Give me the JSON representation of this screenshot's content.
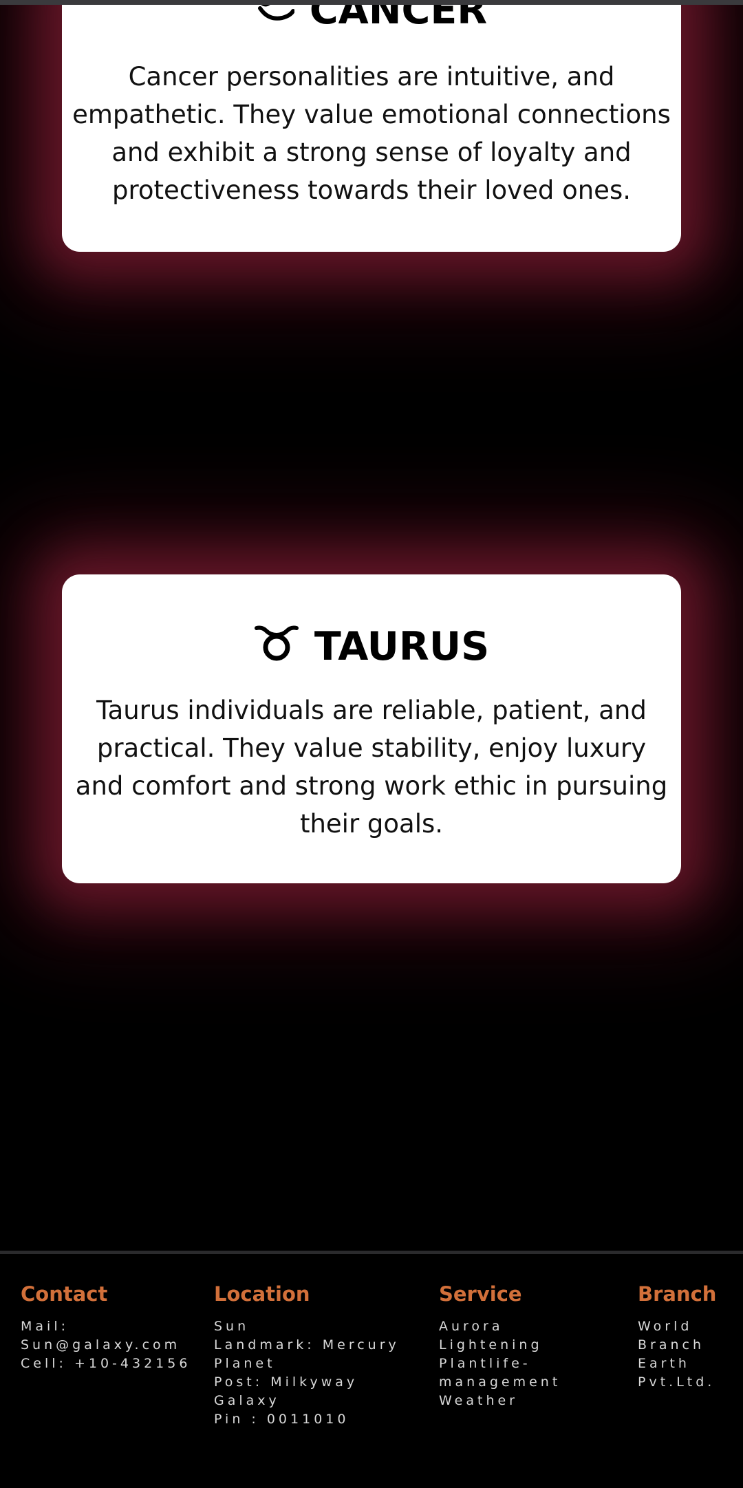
{
  "cards": [
    {
      "title": "CANCER",
      "icon": "cancer-zodiac-icon",
      "description": "Cancer personalities are intuitive, and empathetic. They value emotional connections and exhibit a strong sense of loyalty and protectiveness towards their loved ones."
    },
    {
      "title": "TAURUS",
      "icon": "taurus-zodiac-icon",
      "description": "Taurus individuals are reliable, patient, and practical. They value stability, enjoy luxury and comfort and strong work ethic in pursuing their goals."
    }
  ],
  "footer": {
    "contact": {
      "heading": "Contact",
      "lines": [
        "Mail:",
        "Sun@galaxy.com",
        "Cell: +10-432156"
      ]
    },
    "location": {
      "heading": "Location",
      "lines": [
        "Sun",
        "Landmark: Mercury",
        "Planet",
        "Post: Milkyway",
        "Galaxy",
        "Pin : 0011010"
      ]
    },
    "service": {
      "heading": "Service",
      "lines": [
        "Aurora",
        "Lightening",
        "Plantlife-",
        "management",
        "Weather"
      ]
    },
    "branch": {
      "heading": "Branch",
      "lines": [
        "World",
        "Branch",
        "Earth",
        "Pvt.Ltd."
      ]
    }
  },
  "colors": {
    "page_background": "#000000",
    "card_background": "#ffffff",
    "card_glow": "#6e182c",
    "footer_heading": "#d2703a",
    "footer_text": "#d8d8d8"
  }
}
